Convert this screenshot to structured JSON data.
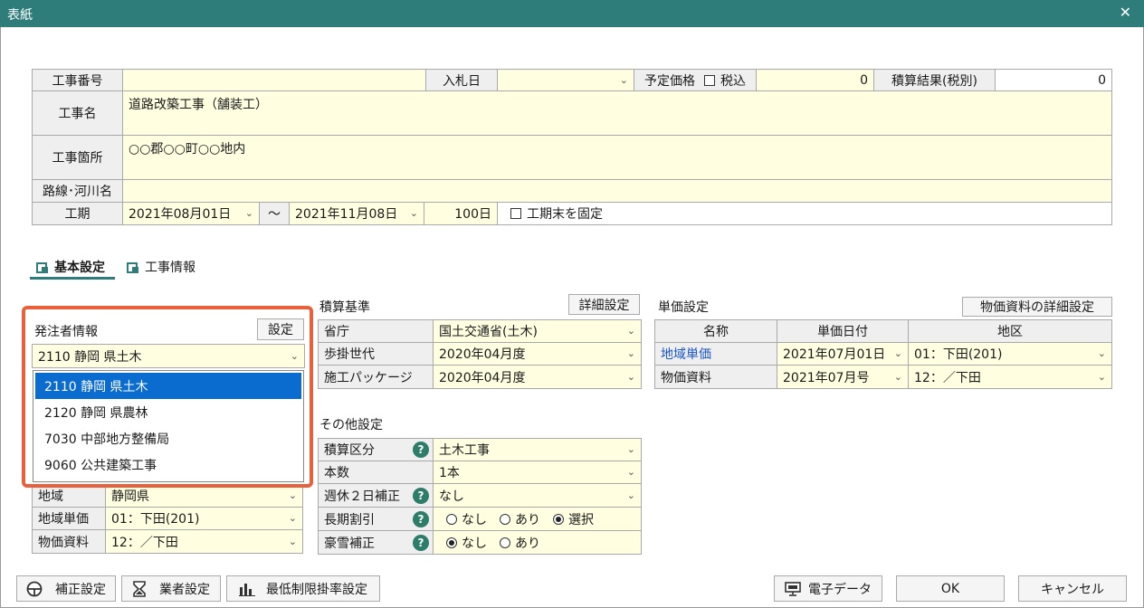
{
  "window": {
    "title": "表紙",
    "close": "✕"
  },
  "header_table": {
    "koji_bango_label": "工事番号",
    "koji_bango_value": "",
    "nyusatsu_bi_label": "入札日",
    "nyusatsu_bi_value": "",
    "yotei_kakaku_label": "予定価格",
    "zeikomi_label": "税込",
    "yotei_kakaku_value": "0",
    "sekisan_kekka_label": "積算結果(税別)",
    "sekisan_kekka_value": "0",
    "koji_mei_label": "工事名",
    "koji_mei_value": "道路改築工事（舗装工）",
    "koji_kasho_label": "工事箇所",
    "koji_kasho_value": "○○郡○○町○○地内",
    "rosen_label": "路線･河川名",
    "rosen_value": "",
    "koki_label": "工期",
    "koki_start": "2021年08月01日",
    "tilde": "～",
    "koki_end": "2021年11月08日",
    "koki_days": "100日",
    "koki_fix_label": "工期末を固定"
  },
  "tabs": [
    {
      "label": "基本設定",
      "active": true
    },
    {
      "label": "工事情報",
      "active": false
    }
  ],
  "hacchusha": {
    "title": "発注者情報",
    "settei_button": "設定",
    "selected": "2110 静岡 県土木",
    "options": [
      "2110 静岡 県土木",
      "2120 静岡 県農林",
      "7030 中部地方整備局",
      "9060 公共建築工事"
    ],
    "highlight_color": "#e8613c",
    "rows": [
      {
        "label": "地域",
        "value": "静岡県"
      },
      {
        "label": "地域単価",
        "value": "01：下田(201)"
      },
      {
        "label": "物価資料",
        "value": "12：／下田"
      }
    ]
  },
  "sekisan_kijun": {
    "title": "積算基準",
    "detail_button": "詳細設定",
    "rows": [
      {
        "label": "省庁",
        "value": "国土交通省(土木)"
      },
      {
        "label": "歩掛世代",
        "value": "2020年04月度"
      },
      {
        "label": "施工パッケージ",
        "value": "2020年04月度"
      }
    ]
  },
  "sonota": {
    "title": "その他設定",
    "rows": [
      {
        "label": "積算区分",
        "value": "土木工事",
        "help": "?"
      },
      {
        "label": "本数",
        "value": "1本"
      },
      {
        "label": "週休２日補正",
        "value": "なし",
        "help": "?"
      },
      {
        "label": "長期割引",
        "help": "?",
        "options": [
          "なし",
          "あり",
          "選択"
        ],
        "selected_index": 2
      },
      {
        "label": "豪雪補正",
        "help": "?",
        "options": [
          "なし",
          "あり"
        ],
        "selected_index": 0
      }
    ]
  },
  "tanka": {
    "title": "単価設定",
    "detail_button": "物価資料の詳細設定",
    "columns": [
      "名称",
      "単価日付",
      "地区"
    ],
    "rows": [
      [
        "地域単価",
        "2021年07月01日",
        "01：下田(201)"
      ],
      [
        "物価資料",
        "2021年07月号",
        "12：／下田"
      ]
    ]
  },
  "footer": {
    "hosei_button": "補正設定",
    "gyosha_button": "業者設定",
    "saitei_button": "最低制限掛率設定",
    "denshi_button": "電子データ",
    "ok_button": "OK",
    "cancel_button": "キャンセル"
  },
  "colors": {
    "titlebar": "#2e7d7a",
    "field_bg": "#fffee0",
    "select": "#0a6ccf",
    "link": "#1a55c8"
  }
}
